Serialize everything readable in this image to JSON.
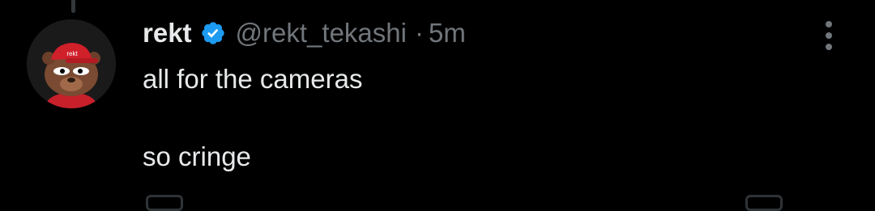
{
  "tweet": {
    "display_name": "rekt",
    "handle": "@rekt_tekashi",
    "separator": "·",
    "timestamp": "5m",
    "verified": true,
    "lines": [
      "all for the cameras",
      "",
      "so cringe"
    ]
  },
  "avatar": {
    "hat_text": "rekt"
  },
  "icons": {
    "verified": "verified-badge-icon",
    "more": "more-options-icon"
  },
  "colors": {
    "background": "#000000",
    "primary_text": "#e7e9ea",
    "secondary_text": "#71767b",
    "verified_blue": "#1d9bf0",
    "hat_red": "#d0202a"
  }
}
